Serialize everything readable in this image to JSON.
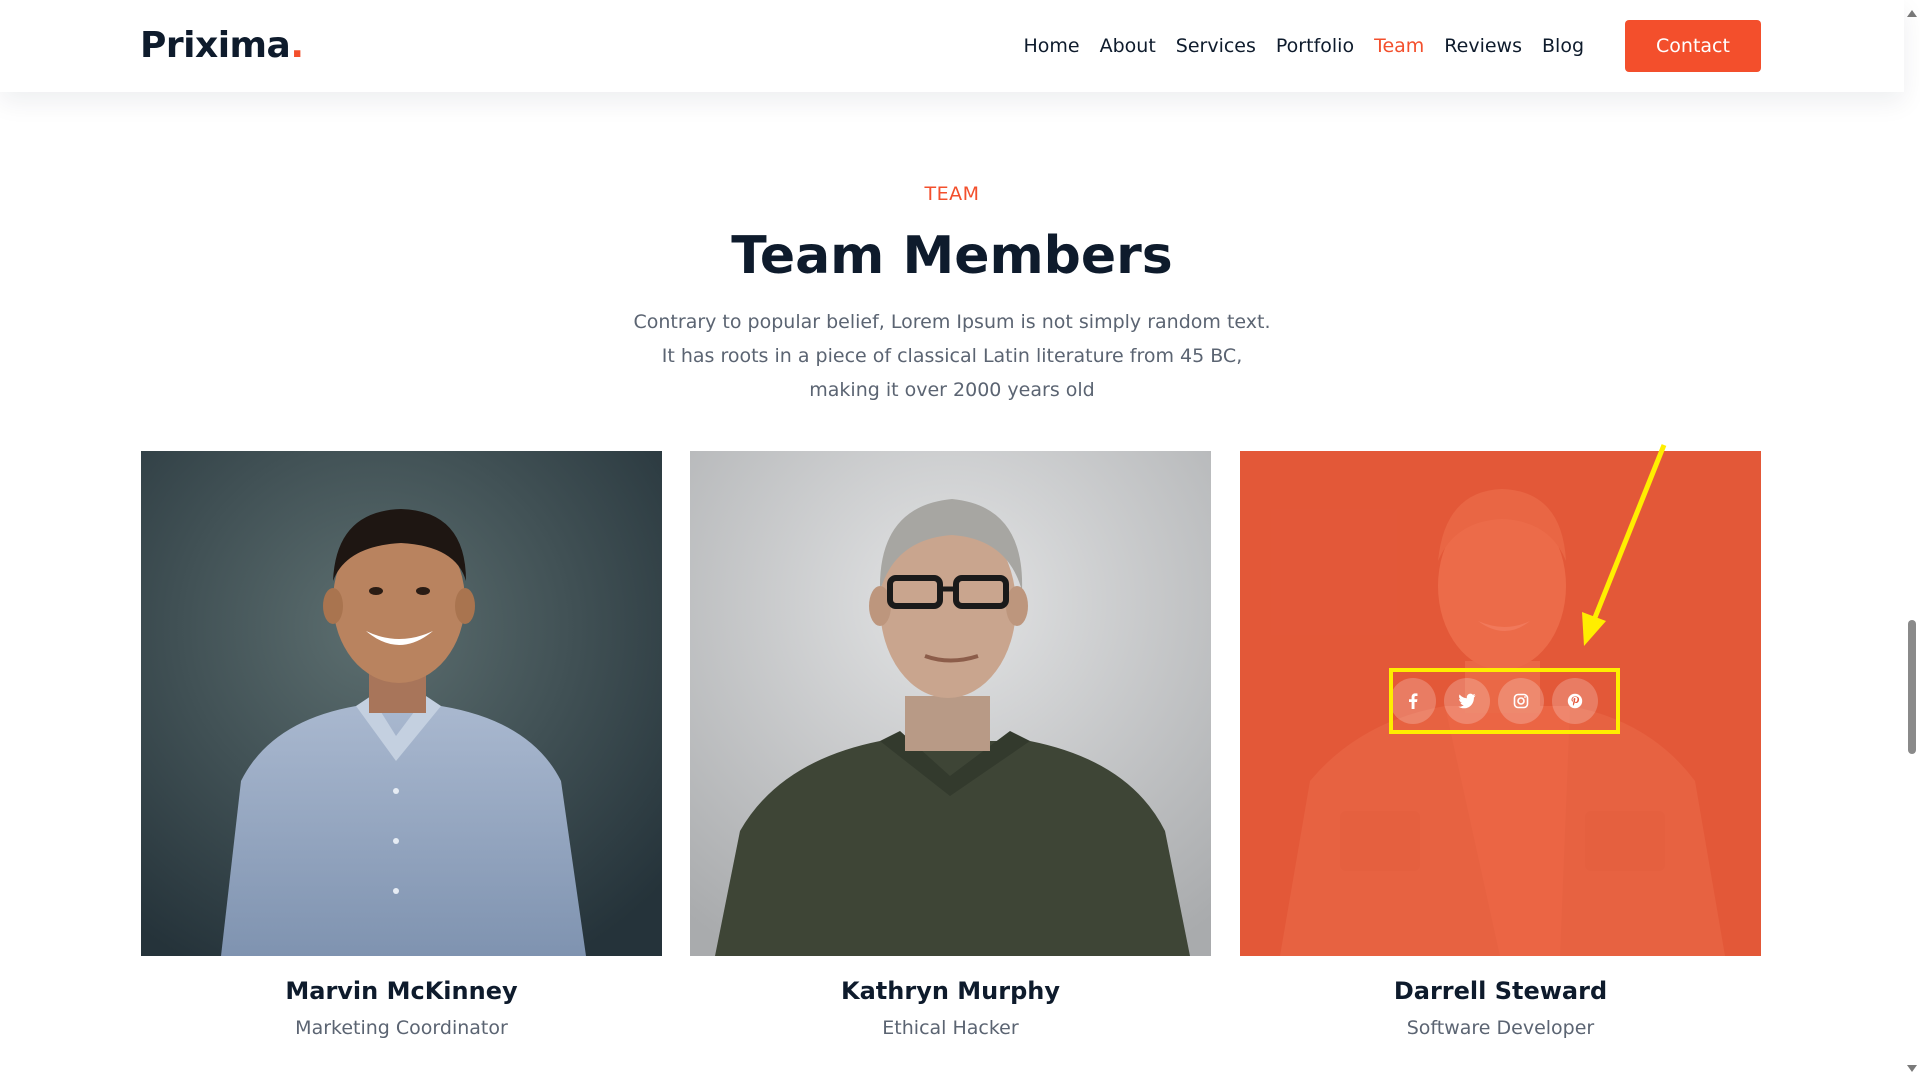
{
  "header": {
    "logo_text": "Prixima",
    "logo_dot": ".",
    "nav": [
      {
        "label": "Home",
        "active": false
      },
      {
        "label": "About",
        "active": false
      },
      {
        "label": "Services",
        "active": false
      },
      {
        "label": "Portfolio",
        "active": false
      },
      {
        "label": "Team",
        "active": true
      },
      {
        "label": "Reviews",
        "active": false
      },
      {
        "label": "Blog",
        "active": false
      }
    ],
    "contact_label": "Contact"
  },
  "section": {
    "eyebrow": "TEAM",
    "title": "Team Members",
    "description": "Contrary to popular belief, Lorem Ipsum is not simply random text. It has roots in a piece of classical Latin literature from 45 BC, making it over 2000 years old"
  },
  "team": [
    {
      "name": "Marvin McKinney",
      "role": "Marketing Coordinator",
      "photo": "portrait-smiling-man-blue-shirt"
    },
    {
      "name": "Kathryn Murphy",
      "role": "Ethical Hacker",
      "photo": "portrait-older-man-glasses"
    },
    {
      "name": "Darrell Steward",
      "role": "Software Developer",
      "photo": "portrait-man-denim-jacket",
      "hover": true
    }
  ],
  "social_icons": [
    "facebook-icon",
    "twitter-icon",
    "instagram-icon",
    "pinterest-icon"
  ],
  "colors": {
    "accent": "#f34f2c",
    "heading": "#0e1b2c",
    "body_text": "#5b6472",
    "annotation": "#ffee00"
  }
}
